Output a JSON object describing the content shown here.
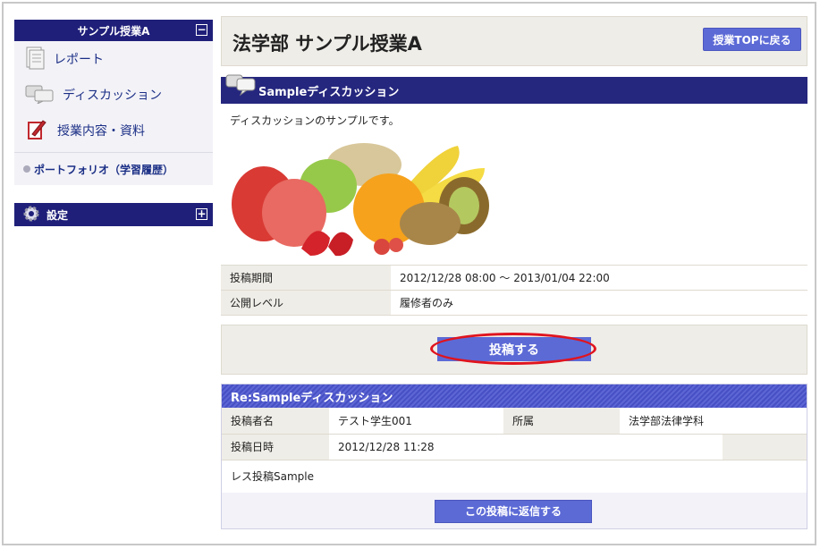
{
  "sidebar": {
    "course_title": "サンプル授業A",
    "collapse_glyph": "−",
    "items": [
      {
        "label": "レポート",
        "icon": "report-icon"
      },
      {
        "label": "ディスカッション",
        "icon": "discussion-icon"
      },
      {
        "label": "授業内容・資料",
        "icon": "materials-icon"
      }
    ],
    "portfolio_label": "ポートフォリオ（学習履歴）",
    "settings_label": "設定",
    "expand_glyph": "+"
  },
  "header": {
    "title": "法学部 サンプル授業A",
    "back_button": "授業TOPに戻る"
  },
  "discussion": {
    "title": "Sampleディスカッション",
    "description": "ディスカッションのサンプルです。",
    "info": [
      {
        "key": "投稿期間",
        "value": "2012/12/28 08:00 〜 2013/01/04 22:00"
      },
      {
        "key": "公開レベル",
        "value": "履修者のみ"
      }
    ],
    "post_button": "投稿する"
  },
  "reply": {
    "title": "Re:Sampleディスカッション",
    "author_label": "投稿者名",
    "author": "テスト学生001",
    "affiliation_label": "所属",
    "affiliation": "法学部法律学科",
    "date_label": "投稿日時",
    "date": "2012/12/28 11:28",
    "body": "レス投稿Sample",
    "reply_button": "この投稿に返信する"
  },
  "colors": {
    "nav": "#1f1f7a",
    "button": "#5c6ad6",
    "highlight_ring": "#e0141e"
  }
}
